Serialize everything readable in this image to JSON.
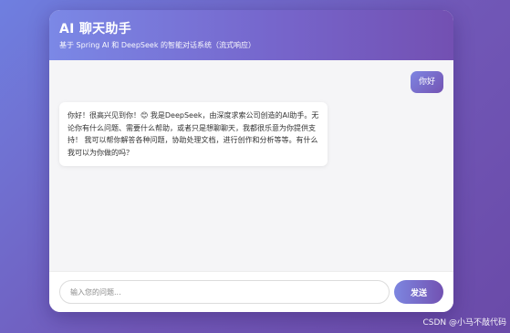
{
  "header": {
    "title": "AI 聊天助手",
    "subtitle": "基于 Spring AI 和 DeepSeek 的智能对话系统（流式响应）"
  },
  "messages": [
    {
      "role": "user",
      "text": "你好"
    },
    {
      "role": "assistant",
      "text": "你好！很高兴见到你！😊 我是DeepSeek，由深度求索公司创造的AI助手。无论你有什么问题、需要什么帮助，或者只是想聊聊天，我都很乐意为你提供支持！ 我可以帮你解答各种问题，协助处理文档，进行创作和分析等等。有什么我可以为你做的吗？"
    }
  ],
  "input": {
    "placeholder": "输入您的问题...",
    "value": ""
  },
  "send_button": {
    "label": "发送"
  },
  "watermark": "CSDN @小马不敲代码",
  "colors": {
    "accent_start": "#7b88e6",
    "accent_end": "#7350b2",
    "background": "#7158b8"
  }
}
